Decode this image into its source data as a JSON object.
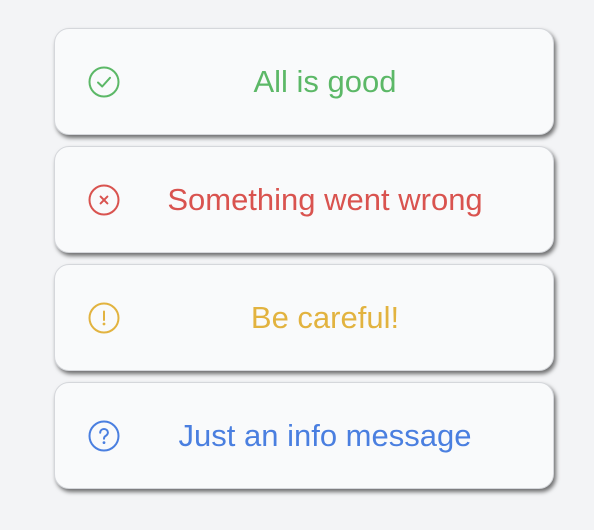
{
  "toasts": [
    {
      "type": "success",
      "message": "All is good",
      "icon": "check-circle-icon",
      "color": "#5cb867"
    },
    {
      "type": "error",
      "message": "Something went wrong",
      "icon": "x-circle-icon",
      "color": "#d9534f"
    },
    {
      "type": "warning",
      "message": "Be careful!",
      "icon": "exclamation-circle-icon",
      "color": "#e2b33f"
    },
    {
      "type": "info",
      "message": "Just an info message",
      "icon": "question-circle-icon",
      "color": "#4a7fe0"
    }
  ]
}
